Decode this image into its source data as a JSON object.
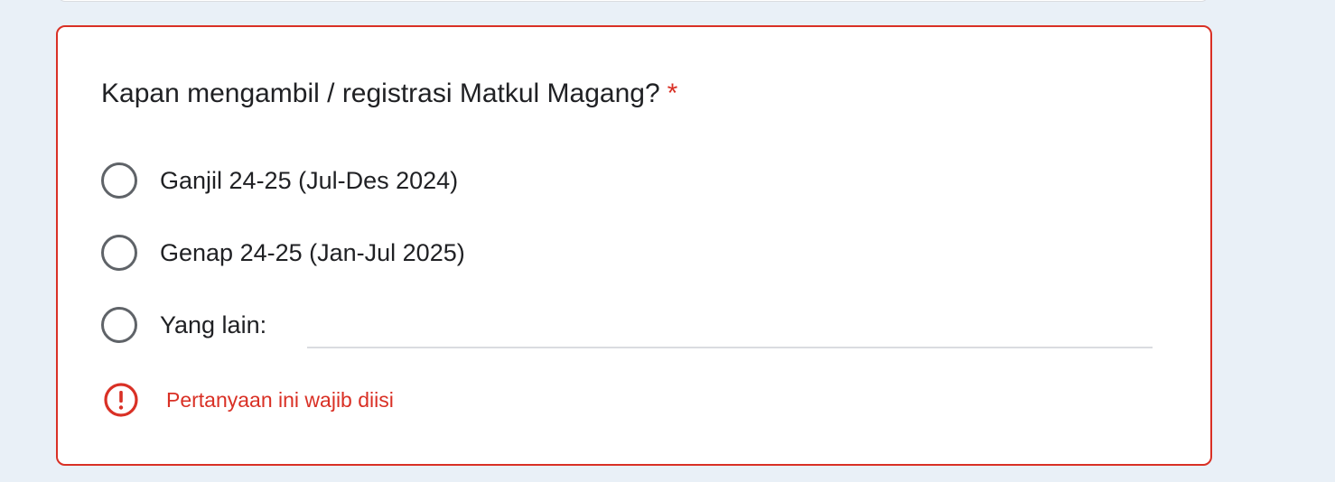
{
  "question": {
    "title": "Kapan mengambil / registrasi Matkul Magang?",
    "required_marker": "*",
    "options": [
      {
        "label": "Ganjil 24-25 (Jul-Des 2024)",
        "selected": false
      },
      {
        "label": "Genap 24-25 (Jan-Jul 2025)",
        "selected": false
      },
      {
        "label": "Yang lain:",
        "selected": false
      }
    ],
    "other_input": {
      "value": "",
      "placeholder": ""
    },
    "error": {
      "icon": "error-circle-icon",
      "message": "Pertanyaan ini wajib diisi"
    }
  },
  "colors": {
    "page_background": "#e9f0f7",
    "card_background": "#ffffff",
    "error": "#d93025",
    "text": "#202124",
    "radio_border": "#5f6368",
    "input_underline": "#dadce0"
  }
}
